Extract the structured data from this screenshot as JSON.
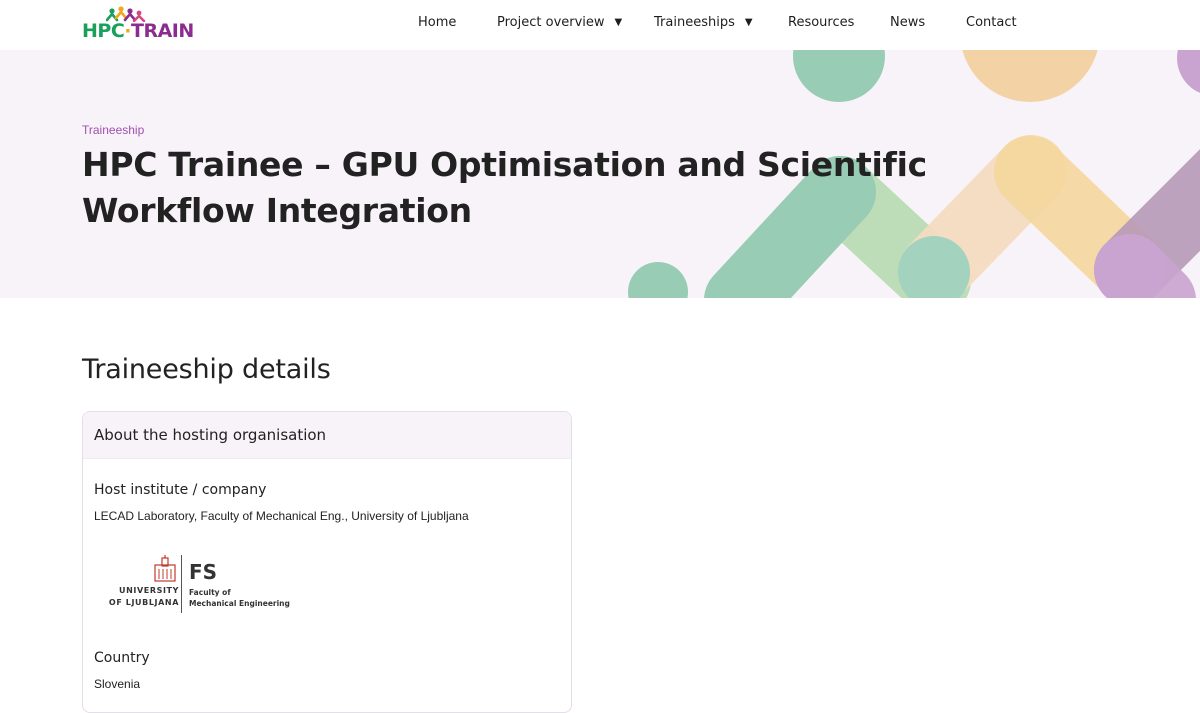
{
  "header": {
    "logo_hpc": "HPC",
    "logo_dot": "·",
    "logo_train": "TRAIN",
    "nav": [
      {
        "label": "Home",
        "has_dropdown": false
      },
      {
        "label": "Project overview",
        "has_dropdown": true
      },
      {
        "label": "Traineeships",
        "has_dropdown": true
      },
      {
        "label": "Resources",
        "has_dropdown": false
      },
      {
        "label": "News",
        "has_dropdown": false
      },
      {
        "label": "Contact",
        "has_dropdown": false
      }
    ]
  },
  "hero": {
    "eyebrow": "Traineeship",
    "title": "HPC Trainee – GPU Optimisation and Scientific Workflow Integration"
  },
  "main": {
    "section_title": "Traineeship details",
    "card": {
      "heading": "About the hosting organisation",
      "host_label": "Host institute / company",
      "host_value": "LECAD Laboratory, Faculty of Mechanical Eng., University of Ljubljana",
      "org_logo": {
        "university_line1": "UNIVERSITY",
        "university_line2": "OF LJUBLJANA",
        "faculty_abbr": "FS",
        "faculty_line1": "Faculty of",
        "faculty_line2": "Mechanical Engineering"
      },
      "country_label": "Country",
      "country_value": "Slovenia"
    }
  },
  "colors": {
    "brand_green": "#1aa05a",
    "brand_purple": "#8b2d8e",
    "brand_orange": "#f1a81f",
    "hero_bg": "#f8f3f8",
    "eyebrow": "#a150b0"
  }
}
